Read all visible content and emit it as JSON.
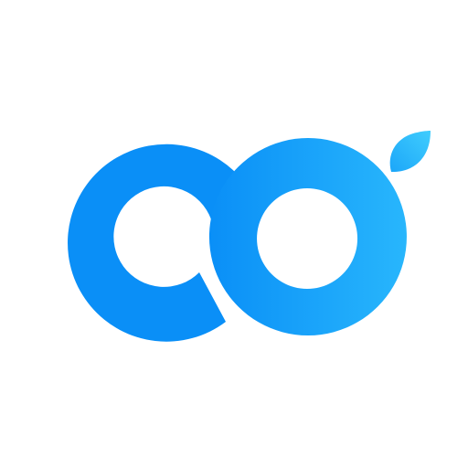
{
  "app_icon": {
    "icon_name": "infinity-leaf-logo-icon",
    "background_color": "#ffffff",
    "colors": {
      "primary_blue": "#0a8ff7",
      "light_blue": "#28b6fc",
      "leaf_light": "#40cdfd"
    }
  }
}
